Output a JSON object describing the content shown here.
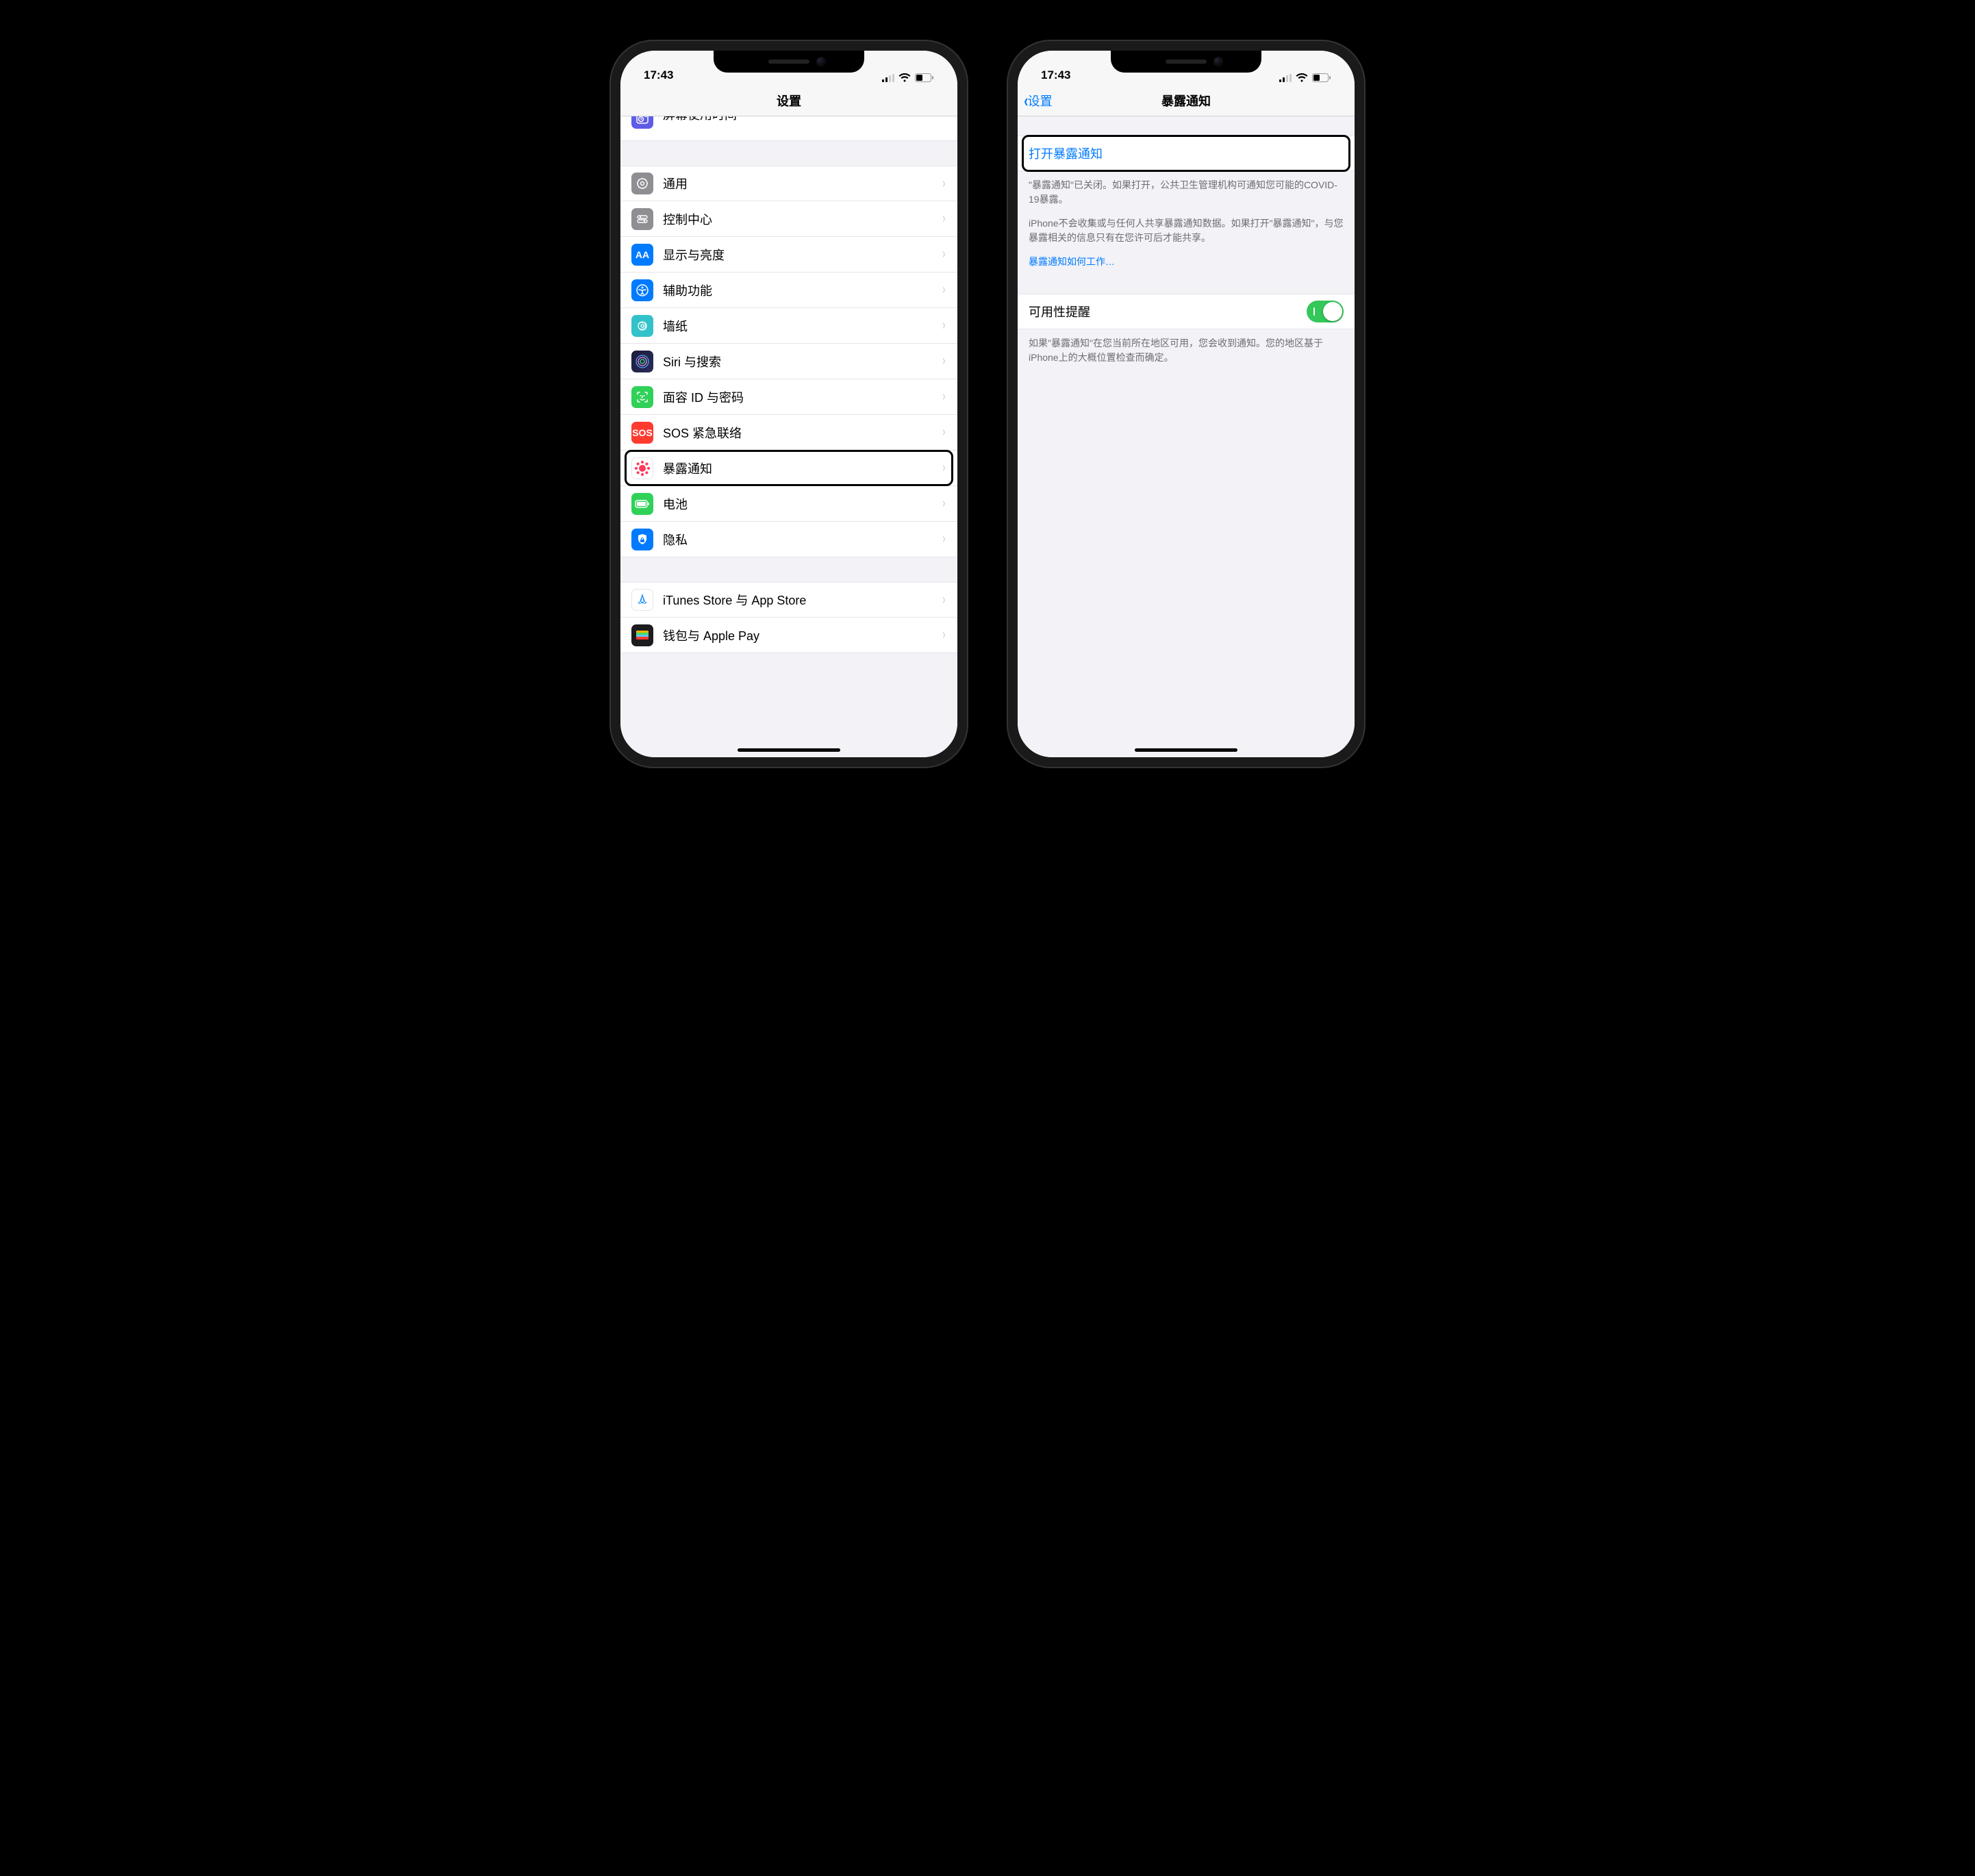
{
  "status": {
    "time": "17:43"
  },
  "left": {
    "nav_title": "设置",
    "partial_row": {
      "label": "屏幕使用时间"
    },
    "groups": [
      {
        "items": [
          {
            "id": "general",
            "icon": "general-icon",
            "label": "通用"
          },
          {
            "id": "control",
            "icon": "control-center-icon",
            "label": "控制中心"
          },
          {
            "id": "display",
            "icon": "display-icon",
            "label": "显示与亮度"
          },
          {
            "id": "access",
            "icon": "accessibility-icon",
            "label": "辅助功能"
          },
          {
            "id": "wallpaper",
            "icon": "wallpaper-icon",
            "label": "墙纸"
          },
          {
            "id": "siri",
            "icon": "siri-icon",
            "label": "Siri 与搜索"
          },
          {
            "id": "faceid",
            "icon": "faceid-icon",
            "label": "面容 ID 与密码"
          },
          {
            "id": "sos",
            "icon": "sos-icon",
            "label": "SOS 紧急联络"
          },
          {
            "id": "exposure",
            "icon": "exposure-icon",
            "label": "暴露通知",
            "highlighted": true
          },
          {
            "id": "battery",
            "icon": "battery-icon",
            "label": "电池"
          },
          {
            "id": "privacy",
            "icon": "privacy-icon",
            "label": "隐私"
          }
        ]
      },
      {
        "items": [
          {
            "id": "itunes",
            "icon": "appstore-icon",
            "label": "iTunes Store 与 App Store"
          },
          {
            "id": "wallet",
            "icon": "wallet-icon",
            "label": "钱包与 Apple Pay"
          }
        ]
      }
    ]
  },
  "right": {
    "back_label": "设置",
    "nav_title": "暴露通知",
    "enable_button": "打开暴露通知",
    "footer_1": "\"暴露通知\"已关闭。如果打开，公共卫生管理机构可通知您可能的COVID-19暴露。",
    "footer_2": "iPhone不会收集或与任何人共享暴露通知数据。如果打开\"暴露通知\"，与您暴露相关的信息只有在您许可后才能共享。",
    "footer_link": "暴露通知如何工作…",
    "availability": {
      "label": "可用性提醒",
      "on": true,
      "footer": "如果\"暴露通知\"在您当前所在地区可用，您会收到通知。您的地区基于iPhone上的大概位置检查而确定。"
    }
  }
}
